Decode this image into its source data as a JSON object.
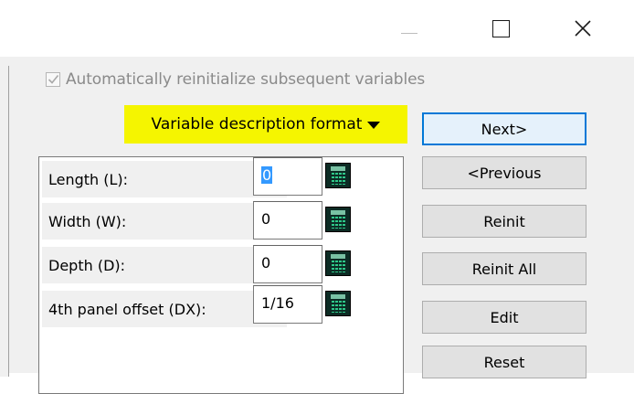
{
  "window": {
    "minimize_icon": "minimize-icon",
    "maximize_icon": "maximize-icon",
    "close_icon": "close-icon"
  },
  "options": {
    "auto_reinit_label": "Automatically reinitialize subsequent variables",
    "auto_reinit_checked": true,
    "auto_reinit_enabled": false
  },
  "format_menu": {
    "label": "Variable description format",
    "highlight_color": "#f5f500"
  },
  "variables": [
    {
      "label": "Length (L):",
      "value": "0",
      "selected": true
    },
    {
      "label": "Width (W):",
      "value": "0",
      "selected": false
    },
    {
      "label": "Depth (D):",
      "value": "0",
      "selected": false
    },
    {
      "label": "4th panel offset (DX):",
      "value": "1/16",
      "selected": false
    }
  ],
  "buttons": {
    "next": "Next>",
    "previous": "<Previous",
    "reinit": "Reinit",
    "reinit_all": "Reinit All",
    "edit": "Edit",
    "reset": "Reset"
  },
  "colors": {
    "accent": "#0078d7",
    "selection": "#3399ff",
    "calculator": "#0c2b24"
  }
}
